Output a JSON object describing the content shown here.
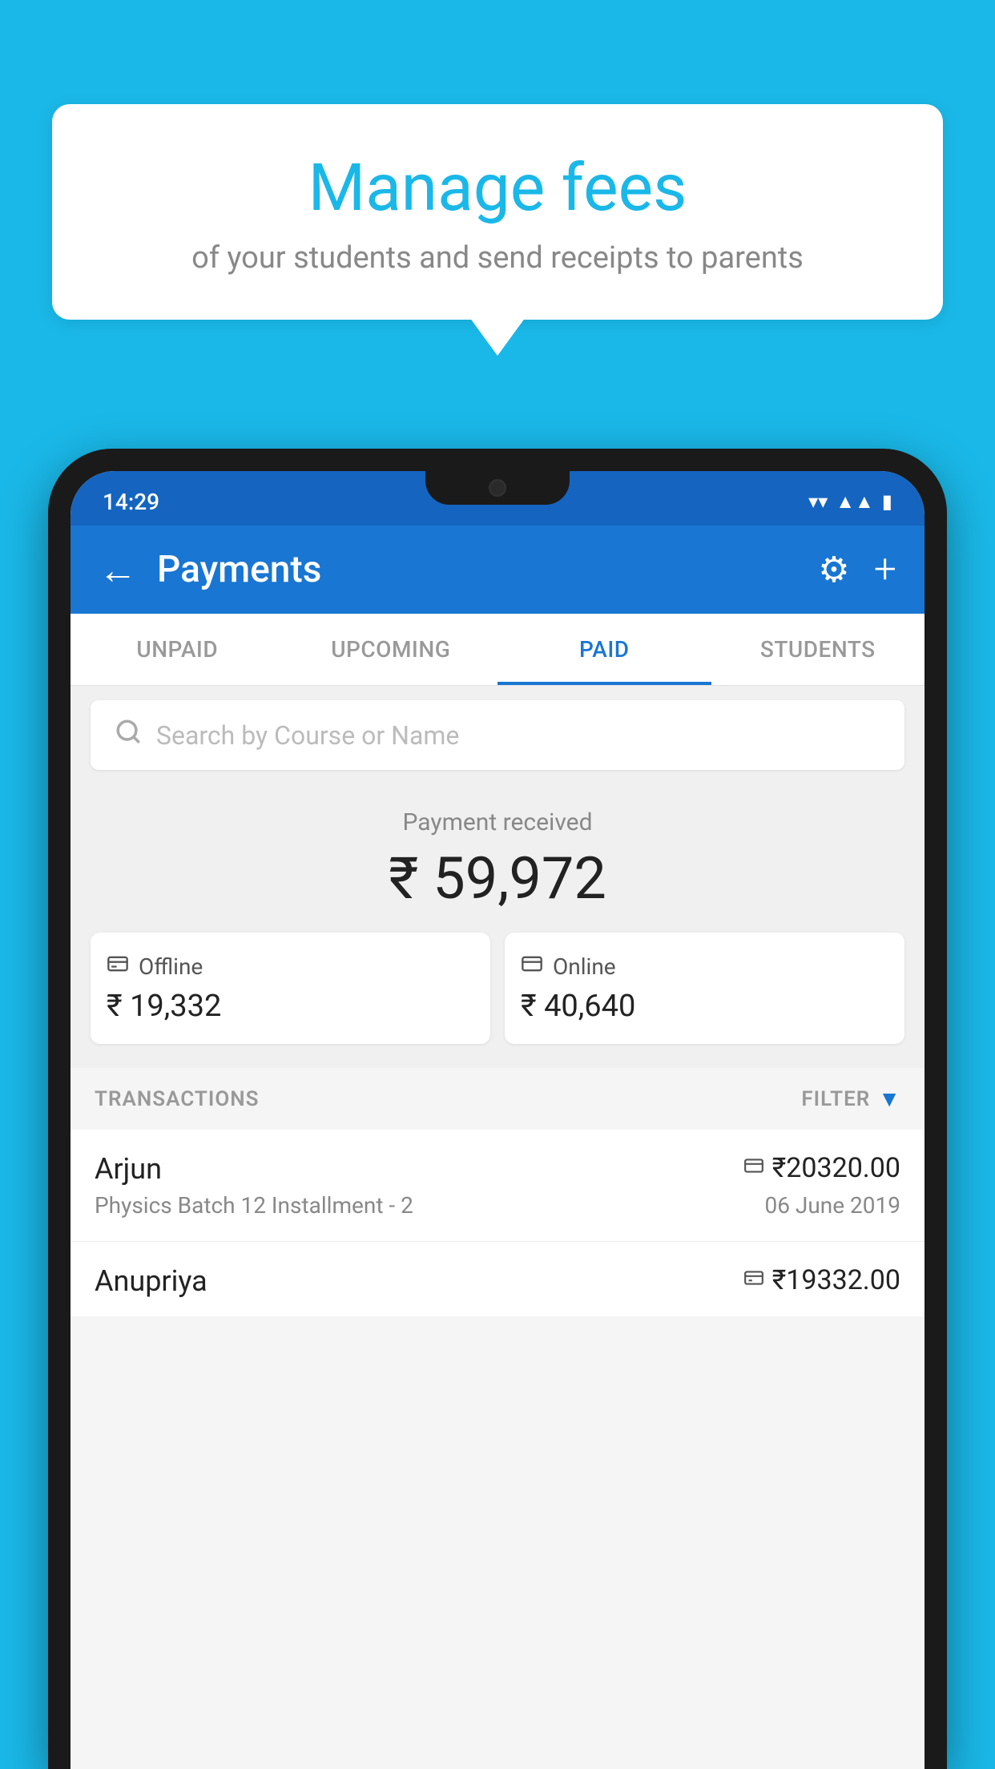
{
  "background_color": "#1ab8e8",
  "speech_bubble": {
    "title": "Manage fees",
    "subtitle": "of your students and send receipts to parents"
  },
  "status_bar": {
    "time": "14:29",
    "icons": [
      "wifi",
      "signal",
      "battery"
    ]
  },
  "app_bar": {
    "back_label": "←",
    "title": "Payments",
    "gear_icon": "⚙",
    "plus_icon": "+"
  },
  "tabs": [
    {
      "label": "UNPAID",
      "active": false
    },
    {
      "label": "UPCOMING",
      "active": false
    },
    {
      "label": "PAID",
      "active": true
    },
    {
      "label": "STUDENTS",
      "active": false
    }
  ],
  "search": {
    "placeholder": "Search by Course or Name"
  },
  "payment_summary": {
    "label": "Payment received",
    "total": "₹ 59,972",
    "offline": {
      "icon": "💳",
      "label": "Offline",
      "amount": "₹ 19,332"
    },
    "online": {
      "icon": "💳",
      "label": "Online",
      "amount": "₹ 40,640"
    }
  },
  "transactions": {
    "header_label": "TRANSACTIONS",
    "filter_label": "FILTER",
    "items": [
      {
        "name": "Arjun",
        "amount_icon": "💳",
        "amount": "₹20320.00",
        "course": "Physics Batch 12 Installment - 2",
        "date": "06 June 2019"
      },
      {
        "name": "Anupriya",
        "amount_icon": "💵",
        "amount": "₹19332.00",
        "course": "",
        "date": ""
      }
    ]
  }
}
